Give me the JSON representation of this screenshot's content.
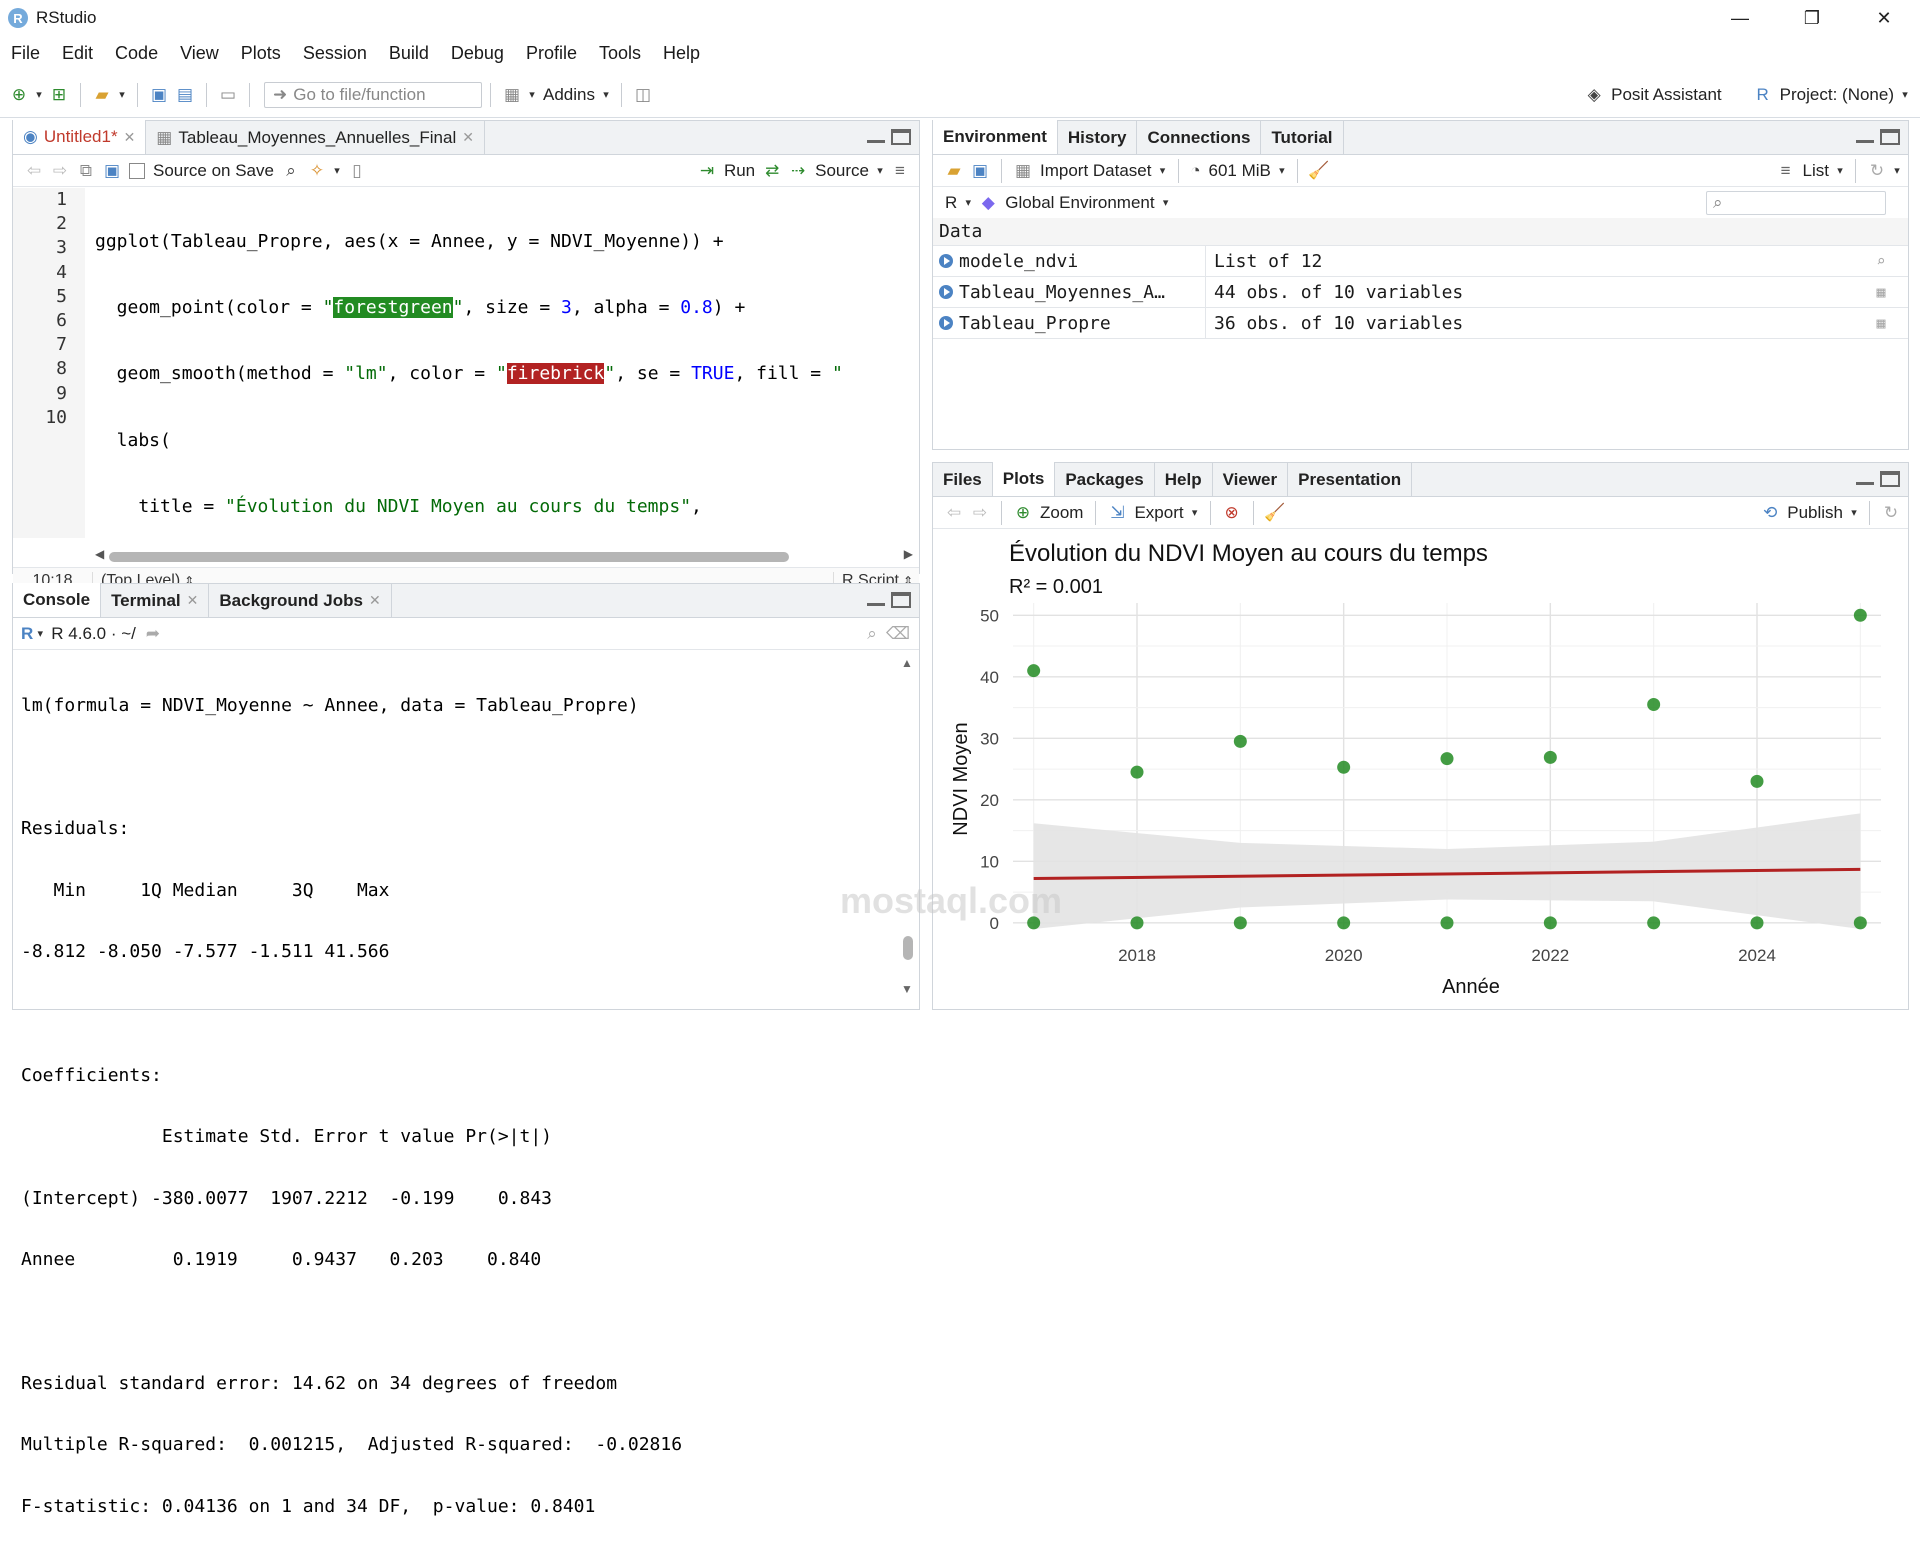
{
  "window": {
    "title": "RStudio",
    "app_icon": "R",
    "controls": [
      "—",
      "❐",
      "✕"
    ]
  },
  "menu": [
    "File",
    "Edit",
    "Code",
    "View",
    "Plots",
    "Session",
    "Build",
    "Debug",
    "Profile",
    "Tools",
    "Help"
  ],
  "toolbar": {
    "goto_placeholder": "Go to file/function",
    "addins": "Addins",
    "assistant": "Posit Assistant",
    "project": "Project: (None)"
  },
  "source": {
    "tabs": [
      "Untitled1*",
      "Tableau_Moyennes_Annuelles_Final"
    ],
    "source_on_save": "Source on Save",
    "run": "Run",
    "source": "Source",
    "line_numbers": [
      "1",
      "2",
      "3",
      "4",
      "5",
      "6",
      "7",
      "8",
      "9",
      "10"
    ],
    "cursor": "10:18",
    "scope": "(Top Level)",
    "filetype": "R Script"
  },
  "console": {
    "tabs": [
      "Console",
      "Terminal",
      "Background Jobs"
    ],
    "version": "R 4.6.0 · ~/",
    "lines": [
      "lm(formula = NDVI_Moyenne ~ Annee, data = Tableau_Propre)",
      "",
      "Residuals:",
      "   Min     1Q Median     3Q    Max ",
      "-8.812 -8.050 -7.577 -1.511 41.566 ",
      "",
      "Coefficients:",
      "             Estimate Std. Error t value Pr(>|t|)",
      "(Intercept) -380.0077  1907.2212  -0.199    0.843",
      "Annee         0.1919     0.9437   0.203    0.840",
      "",
      "Residual standard error: 14.62 on 34 degrees of freedom",
      "Multiple R-squared:  0.001215,\tAdjusted R-squared:  -0.02816 ",
      "F-statistic: 0.04136 on 1 and 34 DF,  p-value: 0.8401"
    ]
  },
  "environment": {
    "tabs": [
      "Environment",
      "History",
      "Connections",
      "Tutorial"
    ],
    "import": "Import Dataset",
    "memory": "601 MiB",
    "list": "List",
    "lang": "R",
    "scope": "Global Environment",
    "section": "Data",
    "rows": [
      {
        "name": "modele_ndvi",
        "value": "List of  12"
      },
      {
        "name": "Tableau_Moyennes_A…",
        "value": "44 obs. of 10 variables"
      },
      {
        "name": "Tableau_Propre",
        "value": "36 obs. of 10 variables"
      }
    ]
  },
  "files_pane": {
    "tabs": [
      "Files",
      "Plots",
      "Packages",
      "Help",
      "Viewer",
      "Presentation"
    ],
    "zoom": "Zoom",
    "export": "Export",
    "publish": "Publish"
  },
  "chart_data": {
    "type": "scatter",
    "title": "Évolution du NDVI Moyen au cours du temps",
    "subtitle": "R² = 0.001",
    "xlabel": "Année",
    "ylabel": "NDVI Moyen",
    "xlim": [
      2016.8,
      2025.2
    ],
    "ylim": [
      -1,
      52
    ],
    "x_ticks": [
      2018,
      2020,
      2022,
      2024
    ],
    "y_ticks": [
      0,
      10,
      20,
      30,
      40,
      50
    ],
    "grid": true,
    "points": [
      {
        "x": 2017,
        "y": 41
      },
      {
        "x": 2017,
        "y": 0
      },
      {
        "x": 2018,
        "y": 24.5
      },
      {
        "x": 2018,
        "y": 0
      },
      {
        "x": 2019,
        "y": 29.5
      },
      {
        "x": 2019,
        "y": 0
      },
      {
        "x": 2020,
        "y": 25.3
      },
      {
        "x": 2020,
        "y": 0
      },
      {
        "x": 2021,
        "y": 26.7
      },
      {
        "x": 2021,
        "y": 0
      },
      {
        "x": 2022,
        "y": 26.9
      },
      {
        "x": 2022,
        "y": 0
      },
      {
        "x": 2023,
        "y": 35.5
      },
      {
        "x": 2023,
        "y": 0
      },
      {
        "x": 2024,
        "y": 23
      },
      {
        "x": 2024,
        "y": 0
      },
      {
        "x": 2025,
        "y": 50
      },
      {
        "x": 2025,
        "y": 0
      }
    ],
    "trend": [
      {
        "x": 2017,
        "y": 7.2
      },
      {
        "x": 2025,
        "y": 8.7
      }
    ],
    "band_upper": [
      {
        "x": 2017,
        "y": 16.2
      },
      {
        "x": 2019,
        "y": 13
      },
      {
        "x": 2021,
        "y": 12
      },
      {
        "x": 2023,
        "y": 13.2
      },
      {
        "x": 2025,
        "y": 17.8
      }
    ],
    "band_lower": [
      {
        "x": 2017,
        "y": -1
      },
      {
        "x": 2019,
        "y": 2.5
      },
      {
        "x": 2021,
        "y": 3.8
      },
      {
        "x": 2023,
        "y": 3.5
      },
      {
        "x": 2025,
        "y": -1
      }
    ],
    "point_color": "#228b22",
    "line_color": "#b22222",
    "band_color": "#e3e3e3"
  },
  "watermark": "mostaql.com"
}
